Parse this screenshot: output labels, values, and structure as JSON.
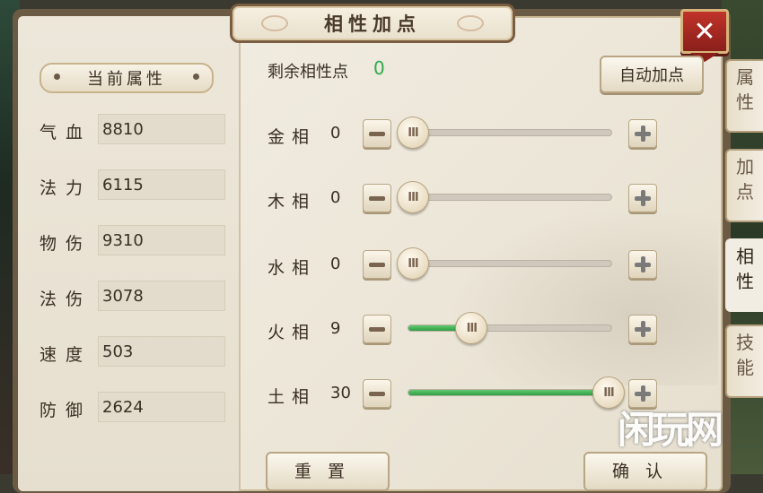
{
  "window": {
    "title": "相性加点",
    "close_label": "✕"
  },
  "attributes": {
    "header": "当前属性",
    "stats": [
      {
        "label": "气血",
        "value": "8810"
      },
      {
        "label": "法力",
        "value": "6115"
      },
      {
        "label": "物伤",
        "value": "9310"
      },
      {
        "label": "法伤",
        "value": "3078"
      },
      {
        "label": "速度",
        "value": "503"
      },
      {
        "label": "防御",
        "value": "2624"
      }
    ]
  },
  "points": {
    "remaining_label": "剩余相性点",
    "remaining_value": "0",
    "auto_button": "自动加点"
  },
  "affinities": [
    {
      "label": "金相",
      "value": "0",
      "fraction": 0.0
    },
    {
      "label": "木相",
      "value": "0",
      "fraction": 0.0
    },
    {
      "label": "水相",
      "value": "0",
      "fraction": 0.0
    },
    {
      "label": "火相",
      "value": "9",
      "fraction": 0.3
    },
    {
      "label": "土相",
      "value": "30",
      "fraction": 1.0
    }
  ],
  "slider_knob_glyph": "III",
  "tabs": [
    {
      "label": "属性",
      "active": false
    },
    {
      "label": "加点",
      "active": false
    },
    {
      "label": "相性",
      "active": true
    },
    {
      "label": "技能",
      "active": false
    }
  ],
  "bottom": {
    "reset_label": "重置",
    "confirm_label": "确认"
  },
  "watermark": {
    "text": "闲玩网"
  },
  "colors": {
    "accent_green": "#2eaa4a",
    "close_red": "#c0332a"
  }
}
